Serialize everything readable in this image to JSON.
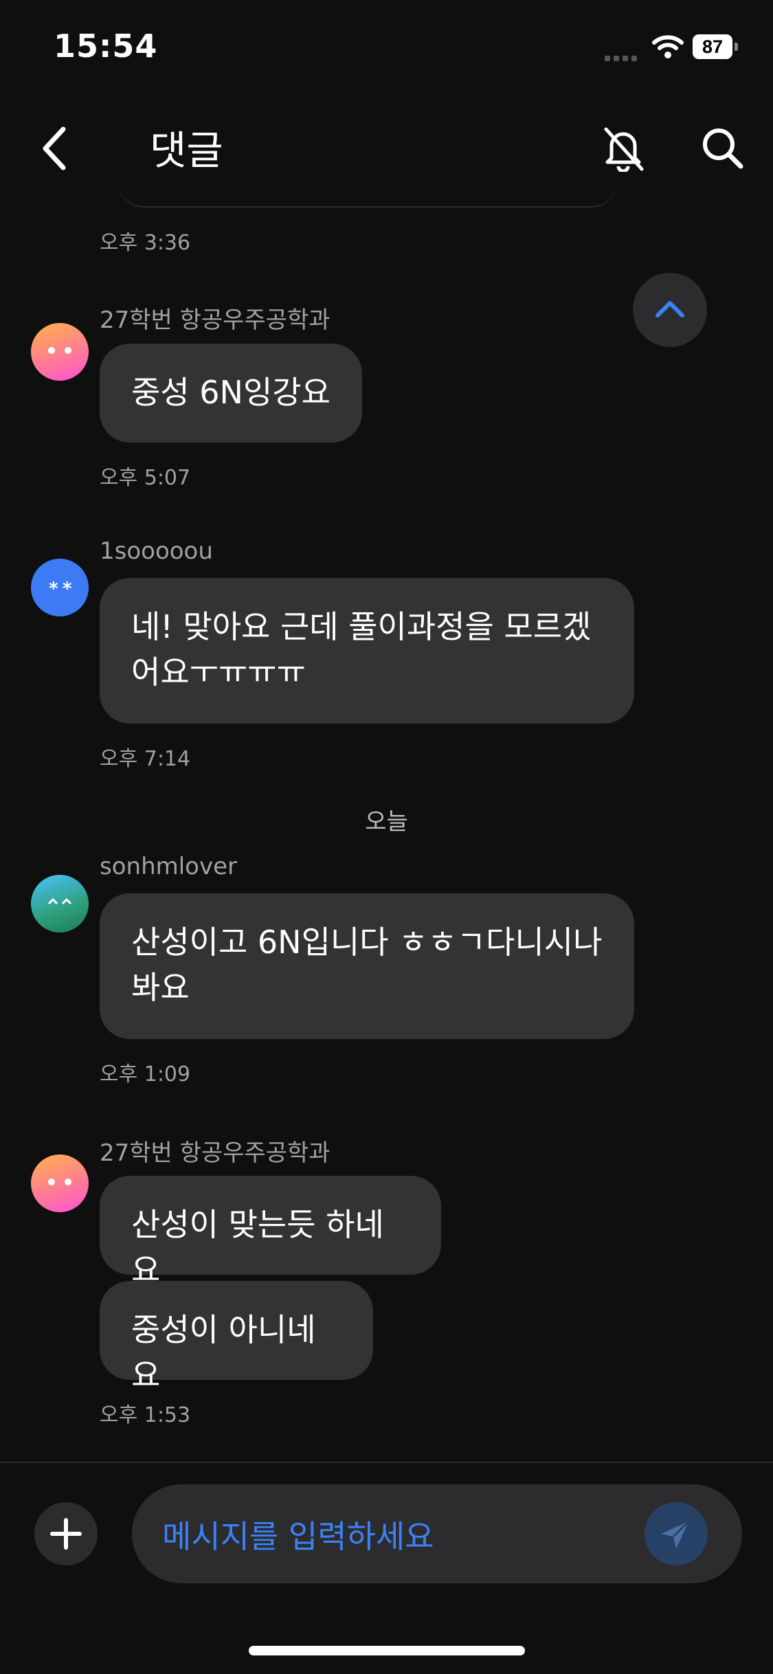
{
  "status_bar": {
    "time": "15:54",
    "battery": "87"
  },
  "header": {
    "title": "댓글"
  },
  "messages": [
    {
      "time": "오후 3:36"
    },
    {
      "sender": "27학번 항공우주공학과",
      "lines": [
        "중성 6N잉강요"
      ],
      "time": "오후 5:07"
    },
    {
      "sender": "1sooooou",
      "lines": [
        "네! 맞아요 근데 풀이과정을 모르겠",
        "어요ㅜㅠㅠㅠ"
      ],
      "time": "오후 7:14"
    },
    {
      "sender": "sonhmlover",
      "lines": [
        "산성이고 6N입니다 ㅎㅎㄱ다니시나",
        "봐요"
      ],
      "time": "오후 1:09"
    },
    {
      "sender": "27학번 항공우주공학과",
      "bubbles": [
        "산성이 맞는듯 하네요",
        "중성이 아니네요"
      ],
      "time": "오후 1:53"
    }
  ],
  "day_divider": "오늘",
  "composer": {
    "placeholder": "메시지를 입력하세요"
  },
  "colors": {
    "accent": "#3b82f6",
    "background": "#0f0f10",
    "bubble": "#333335"
  }
}
